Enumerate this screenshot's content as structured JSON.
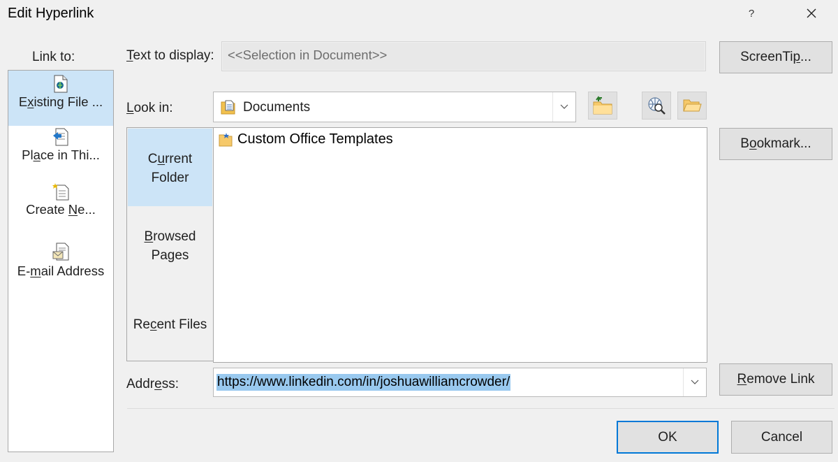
{
  "window": {
    "title": "Edit Hyperlink",
    "help_label": "?",
    "close_label": "✕"
  },
  "link_to": {
    "label": "Link to:",
    "items": [
      {
        "label_pre": "E",
        "label_u": "x",
        "label_post": "isting File ...",
        "icon": "existing-file-icon",
        "selected": true
      },
      {
        "label_pre": "Pl",
        "label_u": "a",
        "label_post": "ce in Thi...",
        "icon": "place-in-document-icon",
        "selected": false
      },
      {
        "label_pre": "Create ",
        "label_u": "N",
        "label_post": "e...",
        "icon": "create-new-document-icon",
        "selected": false
      },
      {
        "label_pre": "E-",
        "label_u": "m",
        "label_post": "ail Address",
        "icon": "email-address-icon",
        "selected": false
      }
    ]
  },
  "text_to_display": {
    "label_u": "T",
    "label_post": "ext to display:",
    "value": "<<Selection in Document>>"
  },
  "screentip_button": {
    "label_pre": "ScreenTi",
    "label_u": "p",
    "label_post": "..."
  },
  "look_in": {
    "label_u": "L",
    "label_post": "ook in:",
    "value": "Documents",
    "icon": "documents-folder-icon"
  },
  "toolbar_icons": [
    "up-one-folder-icon",
    "browse-web-icon",
    "browse-file-icon"
  ],
  "nav": {
    "current_folder": {
      "line1_pre": "C",
      "line1_u": "u",
      "line1_post": "rrent",
      "line2": "Folder"
    },
    "browsed_pages": {
      "line1_u": "B",
      "line1_post": "rowsed",
      "line2": "Pages"
    },
    "recent_files": {
      "pre": "Re",
      "u": "c",
      "post": "ent Files"
    }
  },
  "files": [
    {
      "name": "Custom Office Templates",
      "icon": "folder-icon"
    }
  ],
  "bookmark_button": {
    "label_pre": "B",
    "label_u": "o",
    "label_post": "okmark..."
  },
  "address": {
    "label_pre": "Addr",
    "label_u": "e",
    "label_post": "ss:",
    "value": "https://www.linkedin.com/in/joshuawilliamcrowder/"
  },
  "remove_link_button": {
    "label_u": "R",
    "label_post": "emove Link"
  },
  "ok_button": "OK",
  "cancel_button": "Cancel",
  "colors": {
    "selection": "#cce4f7",
    "accent": "#0078d7",
    "address_highlight": "#99c9ef"
  }
}
